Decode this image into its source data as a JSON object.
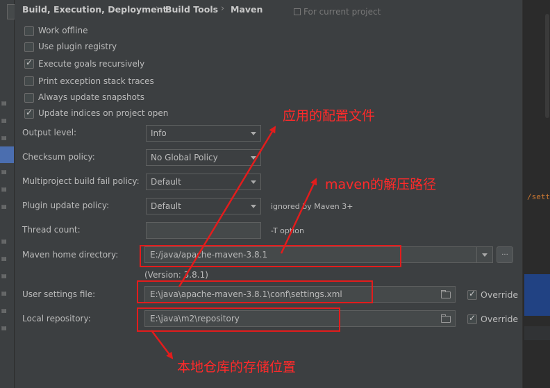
{
  "breadcrumb": {
    "items": [
      "Build, Execution, Deployment",
      "Build Tools",
      "Maven"
    ],
    "separator": "›",
    "scope_note": "For current project"
  },
  "options": [
    {
      "label": "Work offline",
      "checked": false
    },
    {
      "label": "Use plugin registry",
      "checked": false
    },
    {
      "label": "Execute goals recursively",
      "checked": true
    },
    {
      "label": "Print exception stack traces",
      "checked": false
    },
    {
      "label": "Always update snapshots",
      "checked": false
    },
    {
      "label": "Update indices on project open",
      "checked": true
    }
  ],
  "fields": {
    "output_level": {
      "label": "Output level:",
      "value": "Info"
    },
    "checksum_policy": {
      "label": "Checksum policy:",
      "value": "No Global Policy"
    },
    "multiproject_fail_policy": {
      "label": "Multiproject build fail policy:",
      "value": "Default"
    },
    "plugin_update_policy": {
      "label": "Plugin update policy:",
      "value": "Default",
      "note": "ignored by Maven 3+"
    },
    "thread_count": {
      "label": "Thread count:",
      "value": "",
      "note": "-T option"
    },
    "maven_home": {
      "label": "Maven home directory:",
      "value": "E:/java/apache-maven-3.8.1",
      "version": "(Version: 3.8.1)",
      "browse_label": "..."
    },
    "user_settings": {
      "label": "User settings file:",
      "value": "E:\\java\\apache-maven-3.8.1\\conf\\settings.xml",
      "override_label": "Override",
      "override": true
    },
    "local_repository": {
      "label": "Local repository:",
      "value": "E:\\java\\m2\\repository",
      "override_label": "Override",
      "override": true
    }
  },
  "annotations": {
    "config_file": "应用的配置文件",
    "maven_path": "maven的解压路径",
    "repository": "本地仓库的存储位置"
  },
  "editor": {
    "snippet": "/sett"
  },
  "colors": {
    "background": "#3c3f41",
    "annotation": "#e31c1c",
    "selection": "#4b6eaf"
  }
}
